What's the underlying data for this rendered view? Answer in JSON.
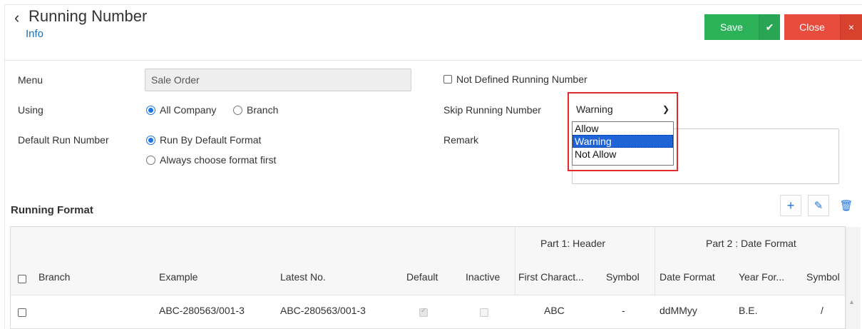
{
  "header": {
    "title": "Running Number",
    "subtitle": "Info",
    "save_label": "Save",
    "close_label": "Close"
  },
  "form": {
    "menu_label": "Menu",
    "menu_value": "Sale Order",
    "using_label": "Using",
    "using_options": [
      "All Company",
      "Branch"
    ],
    "using_selected": "All Company",
    "default_run_label": "Default Run Number",
    "default_run_options": [
      "Run By Default Format",
      "Always choose format first"
    ],
    "default_run_selected": "Run By Default Format",
    "not_defined_label": "Not Defined Running Number",
    "not_defined_checked": false,
    "skip_label": "Skip Running Number",
    "skip_value": "Warning",
    "skip_options": [
      "Allow",
      "Warning",
      "Not Allow"
    ],
    "remark_label": "Remark",
    "remark_value": ""
  },
  "running_format": {
    "title": "Running Format",
    "group_headers": [
      "Part 1: Header",
      "Part 2 : Date Format"
    ],
    "columns": [
      "Branch",
      "Example",
      "Latest No.",
      "Default",
      "Inactive",
      "First Charact...",
      "Symbol",
      "Date Format",
      "Year For...",
      "Symbol"
    ],
    "rows": [
      {
        "branch": "",
        "example": "ABC-280563/001-3",
        "latest_no": "ABC-280563/001-3",
        "default": true,
        "inactive": false,
        "first_char": "ABC",
        "symbol1": "-",
        "date_format": "ddMMyy",
        "year_format": "B.E.",
        "symbol2": "/"
      }
    ]
  },
  "colors": {
    "save": "#2cb35a",
    "close": "#e74c3c",
    "link": "#1a6fb3",
    "highlight_box": "#e32b2b",
    "selected_option": "#1e64d6"
  }
}
